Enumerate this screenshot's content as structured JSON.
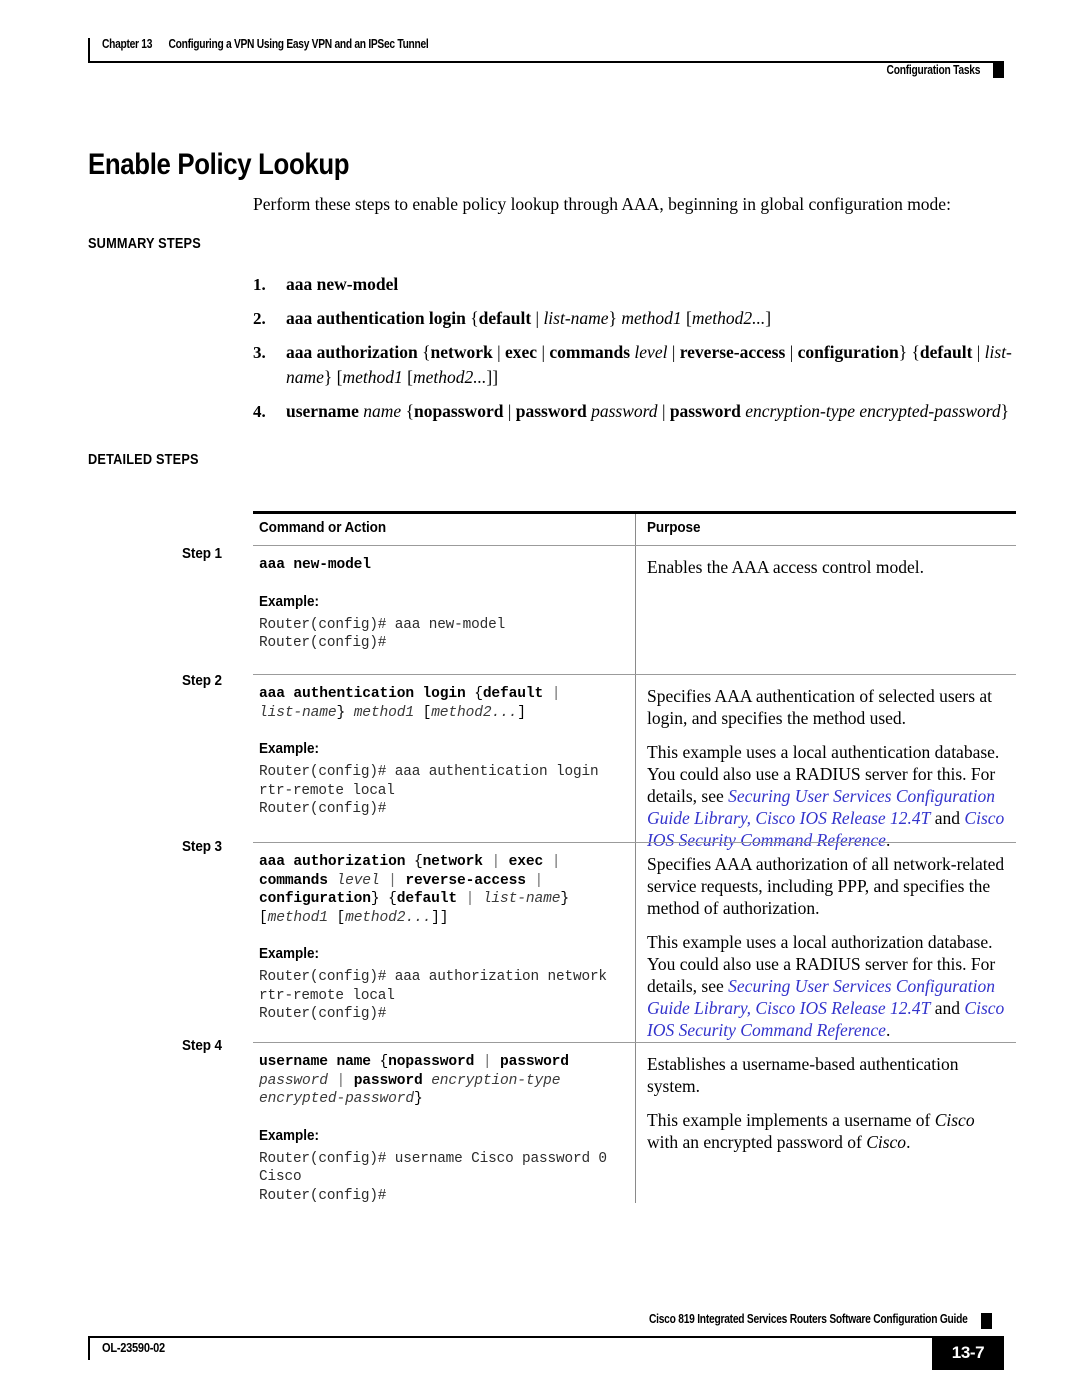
{
  "running_head": {
    "chapter": "Chapter 13",
    "chapter_title": "Configuring a VPN Using Easy VPN and an IPSec Tunnel",
    "section": "Configuration Tasks"
  },
  "page_title": "Enable Policy Lookup",
  "intro": "Perform these steps to enable policy lookup through AAA, beginning in global configuration mode:",
  "headings": {
    "summary": "SUMMARY STEPS",
    "detailed": "DETAILED STEPS"
  },
  "summary_steps": [
    {
      "num": "1.",
      "text": "aaa new-model"
    },
    {
      "num": "2.",
      "text": "aaa authentication login {default | list-name} method1 [method2...]"
    },
    {
      "num": "3.",
      "text": "aaa authorization {network | exec | commands level | reverse-access | configuration} {default | list-name} [method1 [method2...]]"
    },
    {
      "num": "4.",
      "text": "username name {nopassword | password password | password encryption-type encrypted-password}"
    }
  ],
  "table": {
    "headers": {
      "command": "Command or Action",
      "purpose": "Purpose"
    },
    "example_label": "Example:",
    "rows": [
      {
        "step_label": "Step 1",
        "syntax": "aaa new-model",
        "cli": "Router(config)# aaa new-model\nRouter(config)#",
        "purpose_1": "Enables the AAA access control model.",
        "purpose_2": ""
      },
      {
        "step_label": "Step 2",
        "syntax": "aaa authentication login {default | list-name} method1 [method2...]",
        "cli": "Router(config)# aaa authentication login\nrtr-remote local\nRouter(config)#",
        "purpose_1": "Specifies AAA authentication of selected users at login, and specifies the method used.",
        "purpose_2_pre": "This example uses a local authentication database. You could also use a RADIUS server for this. For details, see ",
        "link_1": "Securing User Services Configuration Guide Library, Cisco IOS Release 12.4T",
        "purpose_2_mid": " and ",
        "link_2": "Cisco IOS Security Command Reference",
        "purpose_2_post": "."
      },
      {
        "step_label": "Step 3",
        "syntax": "aaa authorization {network | exec | commands level | reverse-access | configuration} {default | list-name} [method1 [method2...]]",
        "cli": "Router(config)# aaa authorization network\nrtr-remote local\nRouter(config)#",
        "purpose_1": "Specifies AAA authorization of all network-related service requests, including PPP, and specifies the method of authorization.",
        "purpose_2_pre": "This example uses a local authorization database. You could also use a RADIUS server for this. For details, see ",
        "link_1": "Securing User Services Configuration Guide Library, Cisco IOS Release 12.4T",
        "purpose_2_mid": " and ",
        "link_2": "Cisco IOS Security Command Reference",
        "purpose_2_post": "."
      },
      {
        "step_label": "Step 4",
        "syntax": "username name {nopassword | password password | password encryption-type encrypted-password}",
        "cli": "Router(config)# username Cisco password 0\nCisco\nRouter(config)#",
        "purpose_1": "Establishes a username-based authentication system.",
        "purpose_2": "This example implements a username of Cisco with an encrypted password of Cisco."
      }
    ]
  },
  "footer": {
    "guide_title": "Cisco 819 Integrated Services Routers Software Configuration Guide",
    "doc_id": "OL-23590-02",
    "page_number": "13-7"
  },
  "colors": {
    "link": "#3333CC",
    "rule": "#000000",
    "table_rule": "#9B9B9B"
  }
}
